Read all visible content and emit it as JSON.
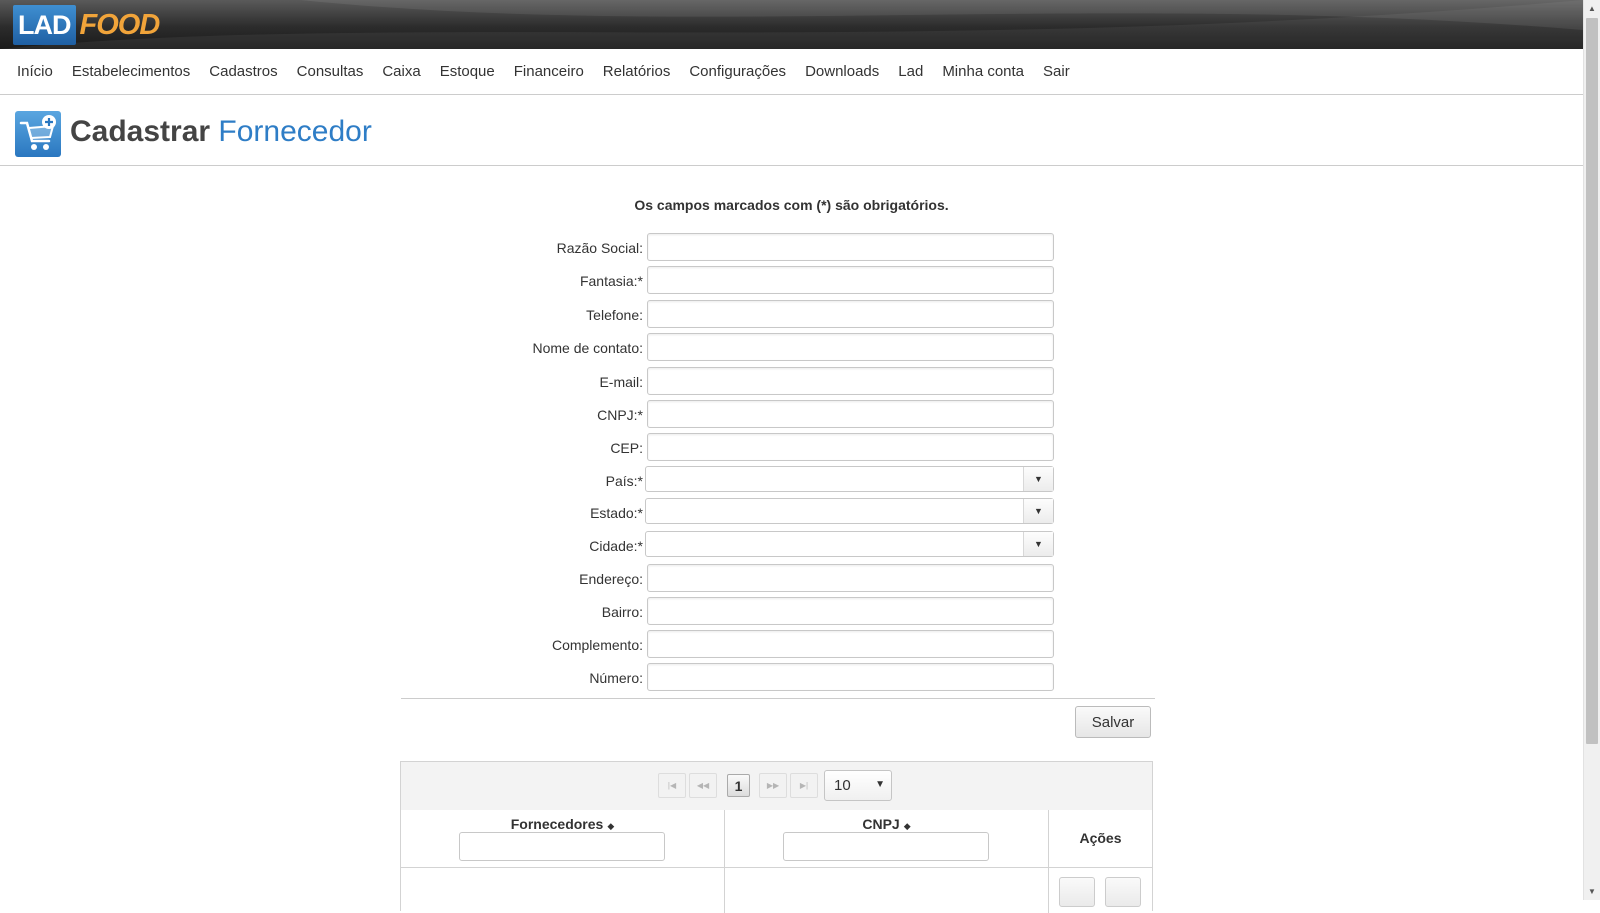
{
  "brand": {
    "part1": "LAD",
    "part2": "FOOD"
  },
  "nav": {
    "items": [
      "Início",
      "Estabelecimentos",
      "Cadastros",
      "Consultas",
      "Caixa",
      "Estoque",
      "Financeiro",
      "Relatórios",
      "Configurações",
      "Downloads",
      "Lad",
      "Minha conta",
      "Sair"
    ]
  },
  "page": {
    "title_main": "Cadastrar",
    "title_accent": "Fornecedor",
    "required_note": "Os campos marcados com (*) são obrigatórios."
  },
  "form": {
    "fields": [
      {
        "label": "Razão Social:",
        "type": "text",
        "value": ""
      },
      {
        "label": "Fantasia:*",
        "type": "text",
        "value": ""
      },
      {
        "label": "Telefone:",
        "type": "text",
        "value": ""
      },
      {
        "label": "Nome de contato:",
        "type": "text",
        "value": ""
      },
      {
        "label": "E-mail:",
        "type": "text",
        "value": ""
      },
      {
        "label": "CNPJ:*",
        "type": "text",
        "value": ""
      },
      {
        "label": "CEP:",
        "type": "text",
        "value": ""
      },
      {
        "label": "País:*",
        "type": "select",
        "value": ""
      },
      {
        "label": "Estado:*",
        "type": "select",
        "value": ""
      },
      {
        "label": "Cidade:*",
        "type": "select",
        "value": ""
      },
      {
        "label": "Endereço:",
        "type": "text",
        "value": ""
      },
      {
        "label": "Bairro:",
        "type": "text",
        "value": ""
      },
      {
        "label": "Complemento:",
        "type": "text",
        "value": ""
      },
      {
        "label": "Número:",
        "type": "text",
        "value": ""
      }
    ],
    "save_label": "Salvar"
  },
  "table": {
    "paginator": {
      "first": "|◀",
      "prev": "◀◀",
      "next": "▶▶",
      "last": "▶|",
      "current_page": "1",
      "rows_per_page": "10"
    },
    "columns": [
      {
        "label": "Fornecedores",
        "sortable": true,
        "filter": ""
      },
      {
        "label": "CNPJ",
        "sortable": true,
        "filter": ""
      },
      {
        "label": "Ações",
        "sortable": false
      }
    ]
  },
  "colors": {
    "accent": "#2e7dc6",
    "brand_food": "#f1a43a",
    "header_dark": "#2c2c2c"
  }
}
